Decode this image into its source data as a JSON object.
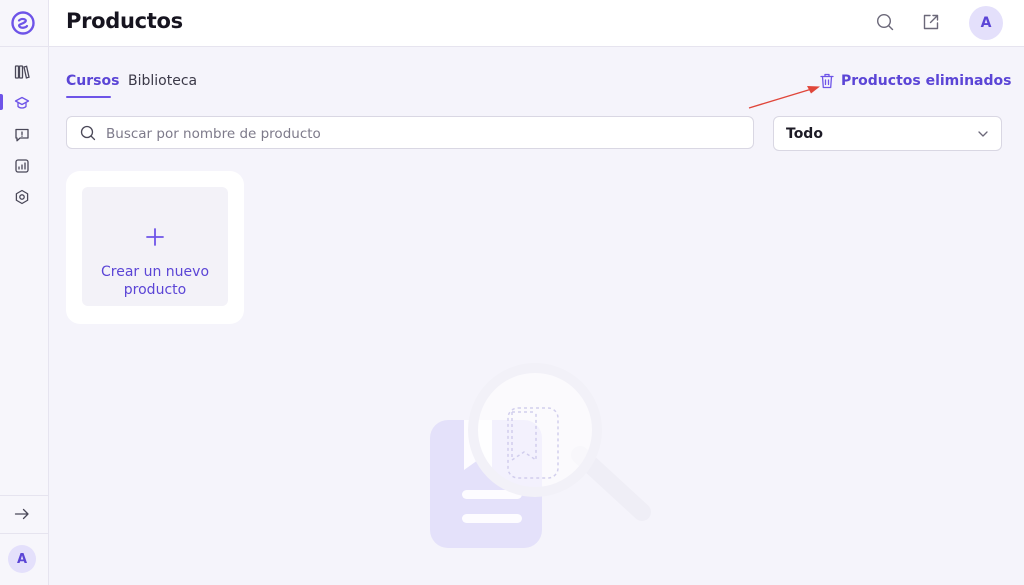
{
  "app": {
    "page_title": "Productos",
    "user_initial": "A"
  },
  "sidebar": {
    "items": [
      {
        "name": "library-icon"
      },
      {
        "name": "courses-icon",
        "active": true
      },
      {
        "name": "chat-icon"
      },
      {
        "name": "analytics-icon"
      },
      {
        "name": "settings-icon"
      }
    ],
    "bottom": [
      {
        "name": "arrow-right-icon"
      }
    ],
    "avatar_initial": "A"
  },
  "topbar": {
    "icons": [
      "search-icon",
      "external-link-icon"
    ],
    "avatar_initial": "A"
  },
  "tabs": [
    {
      "label": "Cursos",
      "active": true
    },
    {
      "label": "Biblioteca",
      "active": false
    }
  ],
  "deleted_products": {
    "label": "Productos eliminados",
    "icon": "trash-icon"
  },
  "search": {
    "placeholder": "Buscar por nombre de producto",
    "value": ""
  },
  "filter": {
    "selected": "Todo"
  },
  "create_card": {
    "label_line1": "Crear un nuevo",
    "label_line2": "producto"
  },
  "colors": {
    "accent": "#6e54e8",
    "annotation": "#e0463a"
  }
}
